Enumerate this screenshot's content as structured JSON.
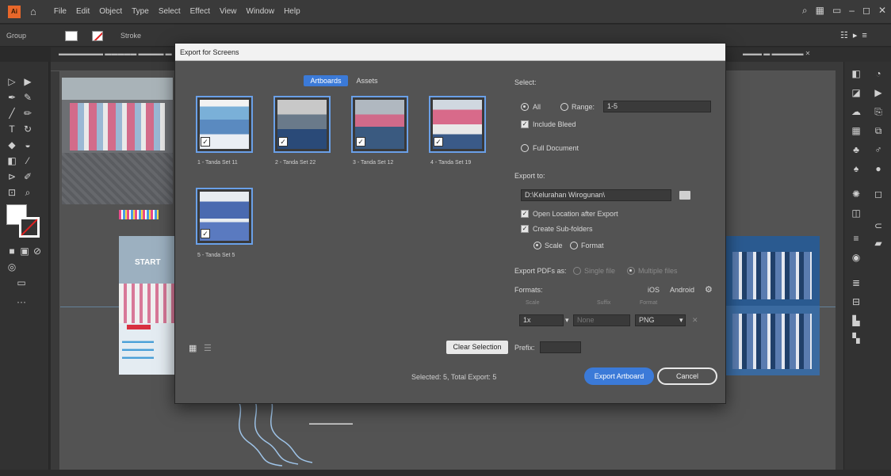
{
  "menubar": {
    "items": [
      "File",
      "Edit",
      "Object",
      "Type",
      "Select",
      "Effect",
      "View",
      "Window",
      "Help"
    ]
  },
  "control": {
    "selection_label": "Group",
    "stroke_label": "Stroke"
  },
  "dialog": {
    "title": "Export for Screens",
    "tabs": [
      "Artboards",
      "Assets"
    ],
    "artboards": [
      {
        "label": "1 - Tanda Set 11"
      },
      {
        "label": "2 - Tanda Set 22"
      },
      {
        "label": "3 - Tanda Set 12"
      },
      {
        "label": "4 - Tanda Set 19"
      },
      {
        "label": "5 - Tanda Set 5"
      }
    ],
    "select_heading": "Select:",
    "all_label": "All",
    "range_label": "Range:",
    "range_value": "1-5",
    "include_bleed_label": "Include Bleed",
    "full_document_label": "Full Document",
    "export_to_label": "Export to:",
    "export_path": "D:\\Kelurahan Wirogunan\\",
    "open_location_label": "Open Location after Export",
    "create_subfolders_label": "Create Sub-folders",
    "scale_label": "Scale",
    "format_label": "Format",
    "export_pdfs_label": "Export PDFs as:",
    "single_file_label": "Single file",
    "multiple_files_label": "Multiple files",
    "formats_heading": "Formats:",
    "ios_label": "iOS",
    "android_label": "Android",
    "col_scale": "Scale",
    "col_suffix": "Suffix",
    "col_format": "Format",
    "scale_value": "1x",
    "suffix_placeholder": "None",
    "format_value": "PNG",
    "prefix_label": "Prefix:",
    "clear_selection_label": "Clear Selection",
    "status": "Selected: 5, Total Export: 5",
    "export_button": "Export Artboard",
    "cancel_button": "Cancel"
  },
  "canvas": {
    "art2_start": "START"
  },
  "colors": {
    "accent": "#3b7ad8",
    "dialog_bg": "#535353",
    "app_bg": "#3a3a3a"
  }
}
